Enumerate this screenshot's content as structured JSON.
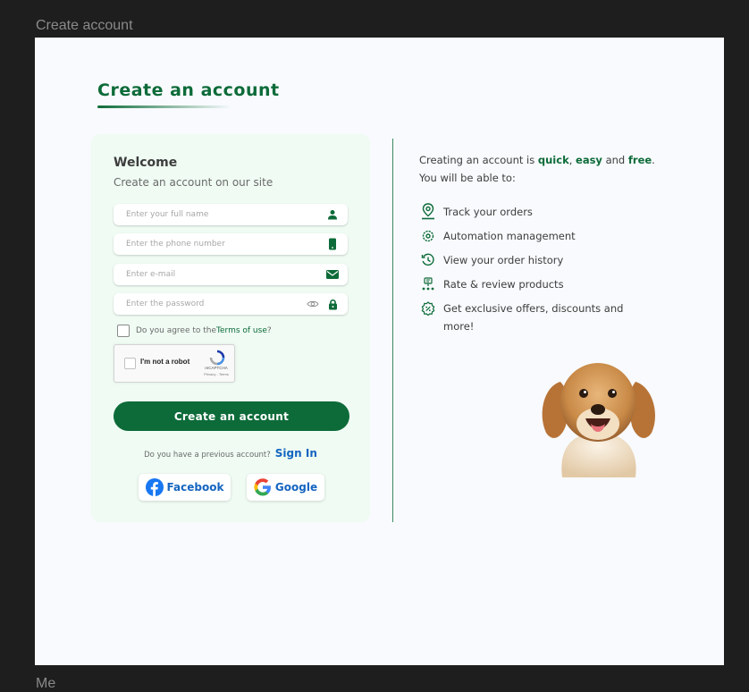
{
  "frame": {
    "title": "Create account",
    "next_frame_partial": "Me"
  },
  "page": {
    "title": "Create an account"
  },
  "form": {
    "welcome": "Welcome",
    "subtitle": "Create an account on our site",
    "full_name_placeholder": "Enter your full name",
    "phone_placeholder": "Enter the phone number",
    "email_placeholder": "Enter e-mail",
    "password_placeholder": "Enter the password",
    "terms_prefix": "Do you agree to the ",
    "terms_link": "Terms of use",
    "terms_suffix": "?",
    "recaptcha": {
      "label": "I'm not a robot",
      "brand": "reCAPTCHA",
      "links": "Privacy - Terms"
    },
    "submit": "Create an account",
    "signin_prompt": "Do you have a previous account?",
    "signin_link": "Sign In",
    "facebook": "Facebook",
    "google": "Google"
  },
  "info": {
    "intro_1": "Creating an account is ",
    "quick": "quick",
    "comma": ", ",
    "easy": "easy",
    "and": " and ",
    "free": "free",
    "period": ".",
    "intro_2": "You will be able to:",
    "benefits": [
      {
        "icon": "location-pin-icon",
        "label": "Track your orders"
      },
      {
        "icon": "gear-icon",
        "label": "Automation management"
      },
      {
        "icon": "history-icon",
        "label": "View your order history"
      },
      {
        "icon": "rating-icon",
        "label": "Rate & review products"
      },
      {
        "icon": "discount-icon",
        "label": "Get exclusive offers, discounts and more!"
      }
    ]
  },
  "colors": {
    "brand_green": "#0d6b39",
    "card_bg": "#effbf3",
    "link_blue": "#1565c0",
    "facebook_blue": "#1877f2"
  }
}
